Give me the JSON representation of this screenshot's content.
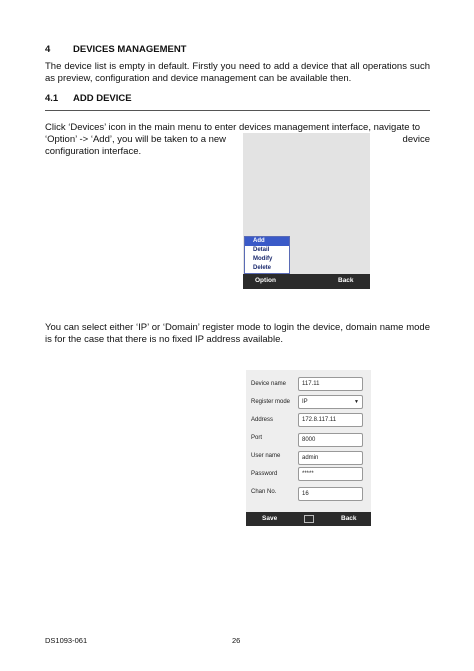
{
  "section": {
    "number": "4",
    "title": "DEVICES MANAGEMENT"
  },
  "intro": "The device list is empty in default. Firstly you need to add a device that all operations such as preview, configuration and device management can be available then.",
  "subsection": {
    "number": "4.1",
    "title": "ADD DEVICE"
  },
  "para_add": {
    "line1": "Click ‘Devices’ icon in the main menu to enter devices management interface, navigate to",
    "line2_left": "‘Option’ -> ‘Add’, you will be taken to a new",
    "line2_right": "device",
    "line3": "configuration interface."
  },
  "menu_screen": {
    "menu_items": [
      "Add",
      "Detail",
      "Modify",
      "Delete"
    ],
    "softkey_left": "Option",
    "softkey_right": "Back"
  },
  "para_mode": "You can select either ‘IP’ or ‘Domain’ register mode to login the device, domain name mode is for the case that there is no fixed IP address available.",
  "form_screen": {
    "fields": [
      {
        "label": "Device name",
        "value": "117.11"
      },
      {
        "label": "Register mode",
        "value": "IP"
      },
      {
        "label": "Address",
        "value": "172.8.117.11"
      },
      {
        "label": "Port",
        "value": "8000"
      },
      {
        "label": "User name",
        "value": "admin"
      },
      {
        "label": "Password",
        "value": "*****"
      },
      {
        "label": "Chan No.",
        "value": "16"
      }
    ],
    "softkey_left": "Save",
    "softkey_right": "Back"
  },
  "footer": {
    "doc_id": "DS1093-061",
    "page": "26"
  }
}
